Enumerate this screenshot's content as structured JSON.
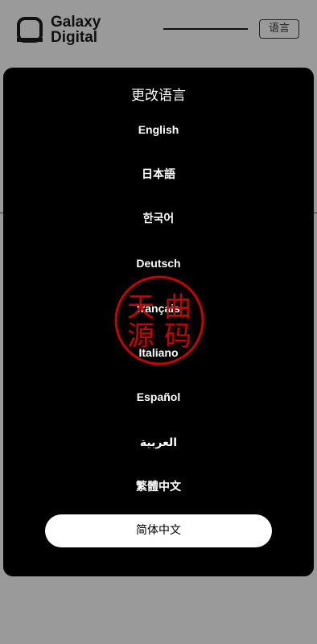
{
  "header": {
    "logo_line1": "Galaxy",
    "logo_line2": "Digital",
    "language_button": "语言"
  },
  "modal": {
    "title": "更改语言",
    "languages": [
      {
        "label": "English"
      },
      {
        "label": "日本語"
      },
      {
        "label": "한국어"
      },
      {
        "label": "Deutsch"
      },
      {
        "label": "français"
      },
      {
        "label": "Italiano"
      },
      {
        "label": "Español"
      },
      {
        "label": "العربية"
      },
      {
        "label": "繁體中文"
      }
    ],
    "selected": "简体中文"
  },
  "watermark": {
    "chars": [
      "天",
      "曲",
      "源",
      "码"
    ],
    "color": "#cc0000"
  }
}
